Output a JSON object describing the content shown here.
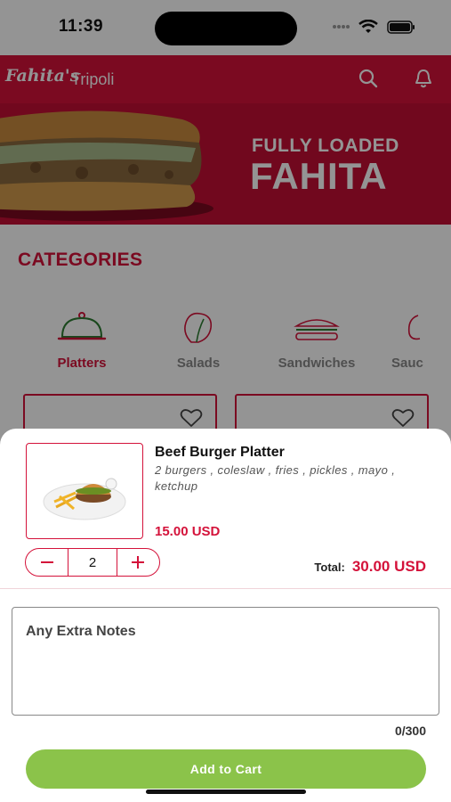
{
  "status_bar": {
    "time": "11:39"
  },
  "header": {
    "logo": "Fahita's",
    "city": "Tripoli"
  },
  "banner": {
    "subtitle": "FULLY LOADED",
    "title": "FAHITA"
  },
  "categories": {
    "title": "CATEGORIES",
    "items": [
      {
        "label": "Platters",
        "active": true
      },
      {
        "label": "Salads",
        "active": false
      },
      {
        "label": "Sandwiches",
        "active": false
      },
      {
        "label": "Sauc",
        "active": false
      }
    ]
  },
  "product": {
    "name": "Beef Burger Platter",
    "description": "2 burgers , coleslaw , fries , pickles , mayo , ketchup",
    "price": "15.00 USD",
    "quantity": "2",
    "total_label": "Total:",
    "total_value": "30.00 USD"
  },
  "notes": {
    "placeholder": "Any Extra Notes",
    "counter": "0/300"
  },
  "actions": {
    "add_to_cart": "Add to Cart"
  },
  "colors": {
    "brand_red": "#d4123a",
    "accent_green": "#8bc34a"
  },
  "icons": [
    "wifi-icon",
    "battery-icon",
    "search-icon",
    "bell-icon",
    "platter-icon",
    "salad-icon",
    "sandwich-icon",
    "sauce-icon",
    "heart-icon",
    "minus-icon",
    "plus-icon"
  ]
}
